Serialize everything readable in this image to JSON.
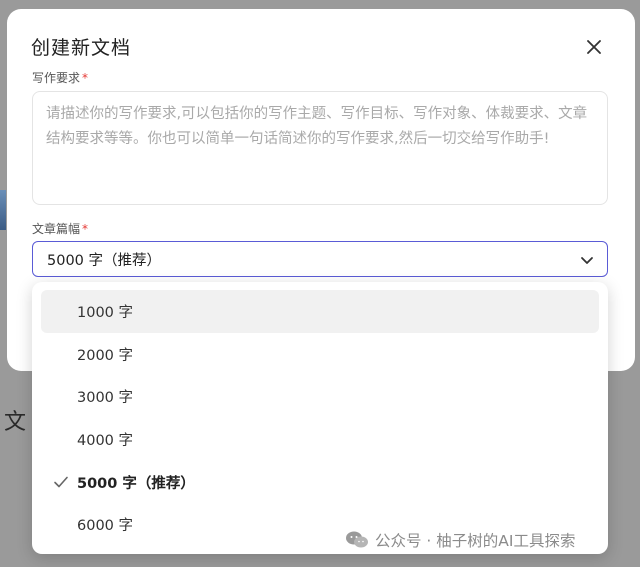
{
  "background": {
    "partial_text": "文"
  },
  "modal": {
    "title": "创建新文档",
    "writing": {
      "label": "写作要求",
      "required_mark": "*",
      "placeholder": "请描述你的写作要求,可以包括你的写作主题、写作目标、写作对象、体裁要求、文章结构要求等等。你也可以简单一句话简述你的写作要求,然后一切交给写作助手!"
    },
    "length": {
      "label": "文章篇幅",
      "required_mark": "*",
      "selected": "5000 字（推荐）",
      "options": [
        {
          "label": "1000 字",
          "hovered": true,
          "selected": false
        },
        {
          "label": "2000 字",
          "hovered": false,
          "selected": false
        },
        {
          "label": "3000 字",
          "hovered": false,
          "selected": false
        },
        {
          "label": "4000 字",
          "hovered": false,
          "selected": false
        },
        {
          "label": "5000 字（推荐）",
          "hovered": false,
          "selected": true
        },
        {
          "label": "6000 字",
          "hovered": false,
          "selected": false
        }
      ]
    }
  },
  "watermark": {
    "text": "公众号 · 柚子树的AI工具探索"
  },
  "colors": {
    "accent": "#5a5bd6",
    "required": "#e53935",
    "overlay": "#9a9a9a"
  }
}
